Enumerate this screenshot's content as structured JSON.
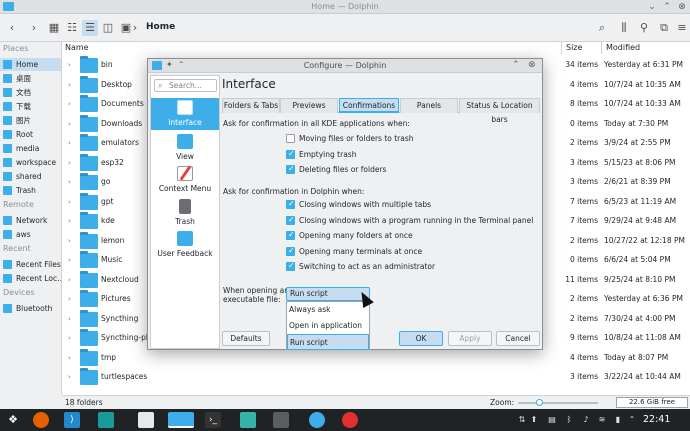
{
  "window": {
    "title": "Home — Dolphin"
  },
  "toolbar": {
    "breadcrumb": "Home"
  },
  "sidebar": {
    "places_header": "Places",
    "places": [
      "Home",
      "桌面",
      "文档",
      "下载",
      "图片",
      "Root",
      "media",
      "workspace",
      "shared",
      "Trash"
    ],
    "remote_header": "Remote",
    "remote": [
      "Network",
      "aws"
    ],
    "recent_header": "Recent",
    "recent": [
      "Recent Files",
      "Recent Loc…"
    ],
    "devices_header": "Devices",
    "devices": [
      "Bluetooth"
    ]
  },
  "files": {
    "col_name": "Name",
    "col_size": "Size",
    "col_modified": "Modified",
    "rows": [
      {
        "name": "bin",
        "size": "34 items",
        "modified": "Yesterday at 6:31 PM"
      },
      {
        "name": "Desktop",
        "size": "4 items",
        "modified": "10/7/24 at 10:35 AM"
      },
      {
        "name": "Documents",
        "size": "8 items",
        "modified": "10/7/24 at 10:33 AM"
      },
      {
        "name": "Downloads",
        "size": "0 items",
        "modified": "Today at 7:30 PM"
      },
      {
        "name": "emulators",
        "size": "2 items",
        "modified": "3/9/24 at 2:55 PM"
      },
      {
        "name": "esp32",
        "size": "3 items",
        "modified": "5/15/23 at 8:06 PM"
      },
      {
        "name": "go",
        "size": "3 items",
        "modified": "2/6/21 at 8:39 PM"
      },
      {
        "name": "gpt",
        "size": "7 items",
        "modified": "6/5/23 at 11:19 AM"
      },
      {
        "name": "kde",
        "size": "7 items",
        "modified": "9/29/24 at 9:48 AM"
      },
      {
        "name": "lemon",
        "size": "2 items",
        "modified": "10/27/22 at 12:18 PM"
      },
      {
        "name": "Music",
        "size": "0 items",
        "modified": "6/6/24 at 5:04 PM"
      },
      {
        "name": "Nextcloud",
        "size": "11 items",
        "modified": "9/25/24 at 8:10 PM"
      },
      {
        "name": "Pictures",
        "size": "2 items",
        "modified": "Yesterday at 6:36 PM"
      },
      {
        "name": "Syncthing",
        "size": "2 items",
        "modified": "7/30/24 at 4:00 PM"
      },
      {
        "name": "Syncthing-pho…",
        "size": "9 items",
        "modified": "10/8/24 at 11:08 AM"
      },
      {
        "name": "tmp",
        "size": "4 items",
        "modified": "Today at 8:07 PM"
      },
      {
        "name": "turtlespaces",
        "size": "3 items",
        "modified": "3/22/24 at 10:44 AM"
      }
    ]
  },
  "statusbar": {
    "count": "18 folders",
    "zoom": "Zoom:",
    "free": "22.6 GiB free"
  },
  "taskbar": {
    "clock": "22:41"
  },
  "dialog": {
    "title": "Configure — Dolphin",
    "search_placeholder": "Search...",
    "categories": [
      "Interface",
      "View",
      "Context Menu",
      "Trash",
      "User Feedback"
    ],
    "heading": "Interface",
    "tabs": [
      "Folders & Tabs",
      "Previews",
      "Confirmations",
      "Panels",
      "Status & Location bars"
    ],
    "section_kde": "Ask for confirmation in all KDE applications when:",
    "kde_options": [
      {
        "label": "Moving files or folders to trash",
        "checked": false
      },
      {
        "label": "Emptying trash",
        "checked": true
      },
      {
        "label": "Deleting files or folders",
        "checked": true
      }
    ],
    "section_dolphin": "Ask for confirmation in Dolphin when:",
    "dolphin_options": [
      {
        "label": "Closing windows with multiple tabs",
        "checked": true
      },
      {
        "label": "Closing windows with a program running in the Terminal panel",
        "checked": true
      },
      {
        "label": "Opening many folders at once",
        "checked": true
      },
      {
        "label": "Opening many terminals at once",
        "checked": true
      },
      {
        "label": "Switching to act as an administrator",
        "checked": true
      }
    ],
    "exec_label_1": "When opening an",
    "exec_label_2": "executable file:",
    "combo_value": "Run script",
    "combo_options": [
      "Always ask",
      "Open in application",
      "Run script"
    ],
    "buttons": {
      "defaults": "Defaults",
      "ok": "OK",
      "apply": "Apply",
      "cancel": "Cancel"
    }
  },
  "colors": {
    "accent": "#3daee9",
    "selection": "#c6dcf0",
    "taskbar": "#1f2326"
  }
}
